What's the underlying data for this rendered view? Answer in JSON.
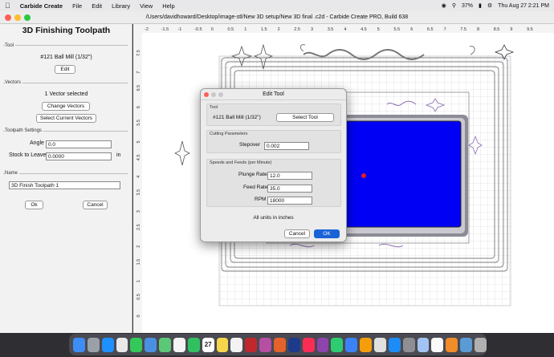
{
  "menubar": {
    "app": "Carbide Create",
    "items": [
      "File",
      "Edit",
      "Library",
      "View",
      "Help"
    ],
    "battery": "37%",
    "datetime": "Thu Aug 27  2:21 PM"
  },
  "window": {
    "title": "/Users/davidhoward/Desktop/image-stl/New 3D setup/New 3D final .c2d - Carbide Create PRO, Build 638"
  },
  "panel": {
    "title": "3D Finishing Toolpath",
    "tool_section": "Tool",
    "tool_name": "#121 Ball Mill (1/32\")",
    "edit_button": "Edit",
    "vectors_section": "Vectors",
    "vectors_status": "1 Vector selected",
    "change_vectors_button": "Change Vectors",
    "select_current_button": "Select Current Vectors",
    "settings_section": "Toolpath Settings",
    "angle_label": "Angle",
    "angle_value": "0.0",
    "stock_label": "Stock to Leave",
    "stock_value": "0.0000",
    "stock_unit": "in",
    "name_section": "Name",
    "name_value": "3D Finish Toolpath 1",
    "ok_button": "Ok",
    "cancel_button": "Cancel"
  },
  "ruler": {
    "top_labels": [
      "-2",
      "-1.5",
      "-1",
      "-0.5",
      "0",
      "0.5",
      "1",
      "1.5",
      "2",
      "2.5",
      "3",
      "3.5",
      "4",
      "4.5",
      "5",
      "5.5",
      "6",
      "6.5",
      "7",
      "7.5",
      "8",
      "8.5",
      "9",
      "9.5"
    ],
    "left_labels": [
      "7.5",
      "7",
      "6.5",
      "6",
      "5.5",
      "5",
      "4.5",
      "4",
      "3.5",
      "3",
      "2.5",
      "2",
      "1.5",
      "1",
      "0.5",
      "0"
    ]
  },
  "dialog": {
    "title": "Edit Tool",
    "tool_section": "Tool",
    "tool_name": "#121 Ball Mill (1/32\")",
    "select_tool_button": "Select Tool",
    "cutting_section": "Cutting Parameters",
    "stepover_label": "Stepover",
    "stepover_value": "0.002",
    "speeds_section": "Speeds and Feeds (per Minute)",
    "plunge_label": "Plunge Rate",
    "plunge_value": "12.0",
    "feed_label": "Feed Rate",
    "feed_value": "35.0",
    "rpm_label": "RPM",
    "rpm_value": "18000",
    "units_note": "All units in inches",
    "cancel_button": "Cancel",
    "ok_button": "OK"
  },
  "colors": {
    "accent_blue": "#1a63d6",
    "design_fill": "#0000f5",
    "close": "#ff5f57",
    "minimize": "#febc2e",
    "zoom": "#28c840"
  },
  "dock": {
    "app_icons": [
      "finder-icon",
      "launchpad-icon",
      "safari-icon",
      "chrome-icon",
      "messages-icon",
      "mail-icon",
      "maps-icon",
      "photos-icon",
      "facetime-icon",
      "calendar-icon",
      "notes-icon",
      "reminders-icon",
      "affinity-designer-icon",
      "affinity-photo-icon",
      "affinity-publisher-icon",
      "photoshop-icon",
      "music-icon",
      "podcasts-icon",
      "numbers-icon",
      "keynote-icon",
      "pages-icon",
      "carbide-create-icon",
      "app-store-icon",
      "system-preferences-icon",
      "preview-icon",
      "textedit-icon",
      "fusion-icon",
      "downloads-icon",
      "trash-icon"
    ]
  },
  "calendar_day": "27"
}
